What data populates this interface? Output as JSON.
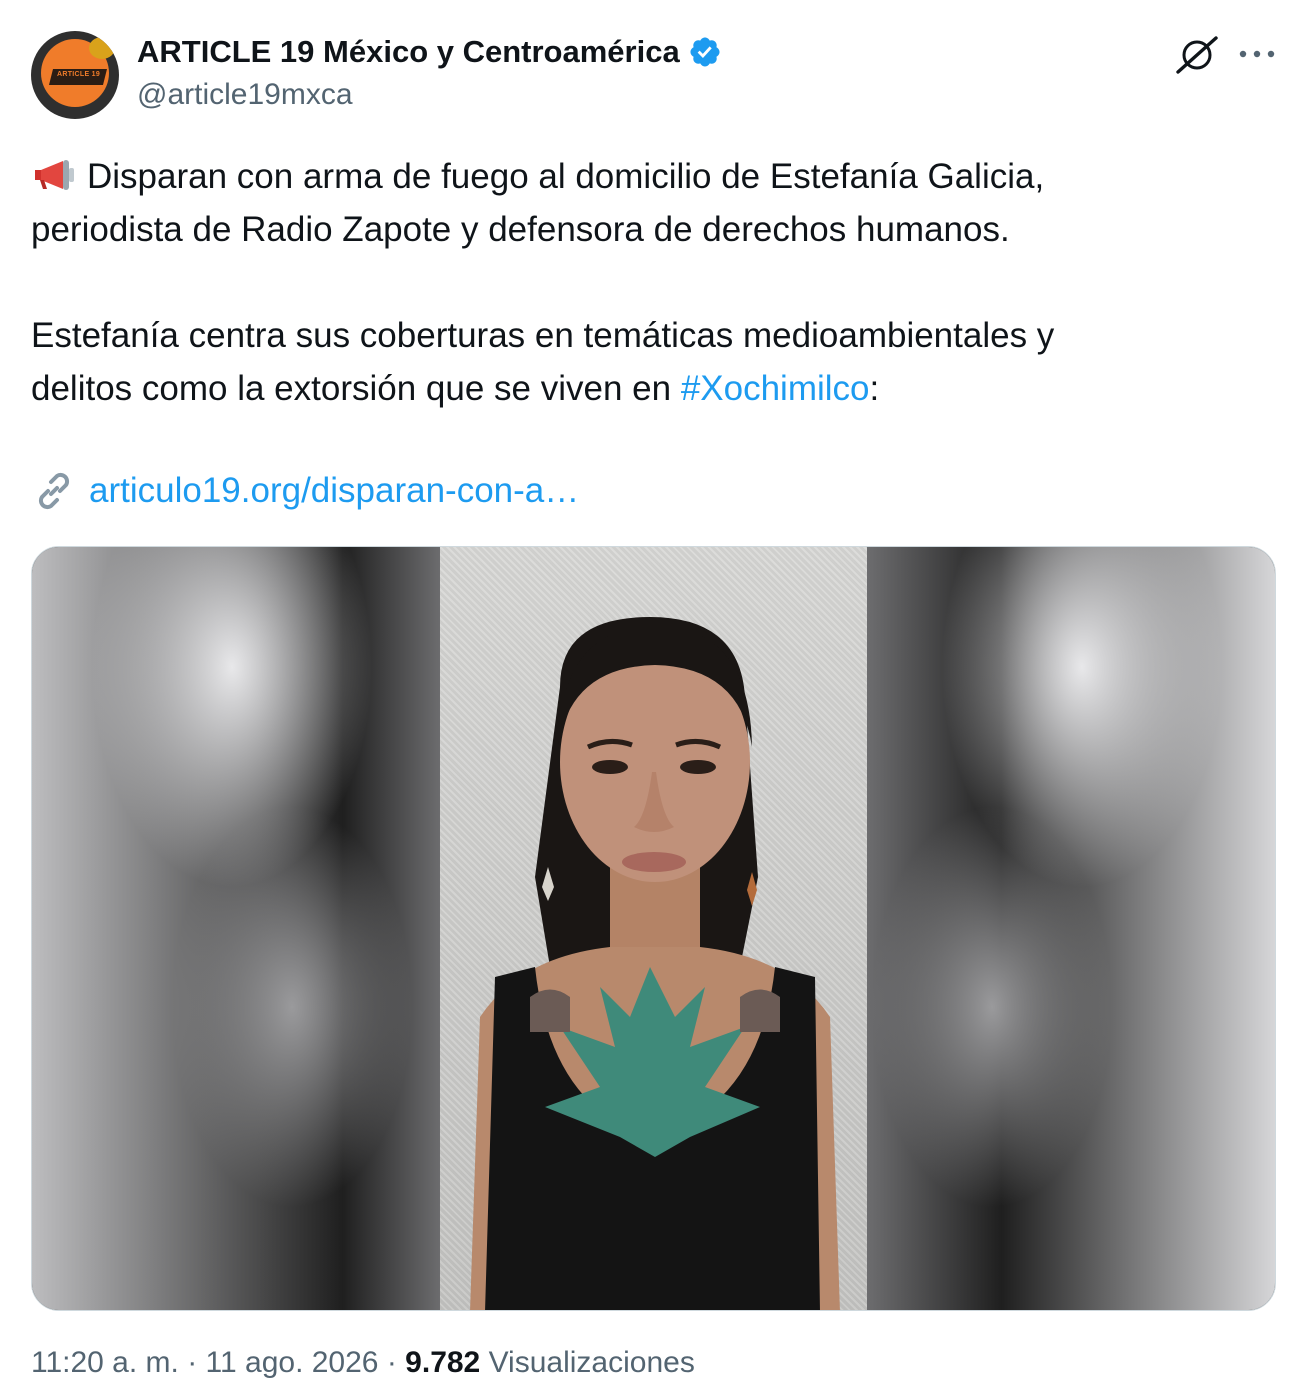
{
  "author": {
    "display_name": "ARTICLE 19 México y Centroamérica",
    "handle": "@article19mxca",
    "verified": true,
    "avatar_text": "ARTICLE 19"
  },
  "actions": {
    "grok_icon": "grok-icon",
    "more_icon": "more-icon"
  },
  "tweet": {
    "emoji": "megaphone-icon",
    "line1": "Disparan con arma de fuego al domicilio de Estefanía Galicia,",
    "line2": "periodista de Radio Zapote y defensora de derechos humanos.",
    "line3": "Estefanía centra sus coberturas en temáticas medioambientales y",
    "line4_prefix": "delitos como la extorsión que se viven en ",
    "hashtag": "#Xochimilco",
    "line4_suffix": ":",
    "link": "articulo19.org/disparan-con-a…"
  },
  "footer": {
    "time": "11:20 a. m.",
    "sep1": " · ",
    "date": "11 ago. 2026",
    "sep2": " · ",
    "views_count": "9.782",
    "views_label": " Visualizaciones"
  },
  "colors": {
    "accent": "#1d9bf0",
    "text": "#0f1419",
    "muted": "#536471",
    "verified": "#1d9bf0"
  }
}
